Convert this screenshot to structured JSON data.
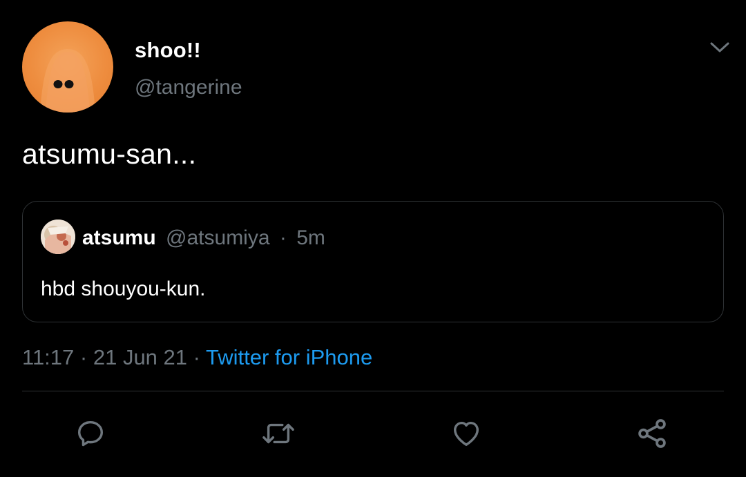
{
  "author": {
    "display_name": "shoo!!",
    "handle": "@tangerine",
    "avatar_icon": "ghost-sheet-avatar"
  },
  "tweet": {
    "text": "atsumu-san..."
  },
  "quoted": {
    "display_name": "atsumu",
    "handle": "@atsumiya",
    "separator": "·",
    "time": "5m",
    "text": "hbd shouyou-kun.",
    "avatar_icon": "anime-avatar"
  },
  "meta": {
    "time": "11:17",
    "separator": " · ",
    "date": "21 Jun 21",
    "source": "Twitter for iPhone"
  },
  "actions": [
    {
      "name": "reply",
      "icon": "reply-icon"
    },
    {
      "name": "retweet",
      "icon": "retweet-icon"
    },
    {
      "name": "like",
      "icon": "heart-icon"
    },
    {
      "name": "share",
      "icon": "share-icon"
    }
  ],
  "colors": {
    "background": "#000000",
    "primary_text": "#ffffff",
    "secondary_text": "#6e767d",
    "link": "#1d9bf0",
    "border": "#2f3336",
    "icon": "#6e767d",
    "avatar_orange": "#ee8d3f"
  }
}
